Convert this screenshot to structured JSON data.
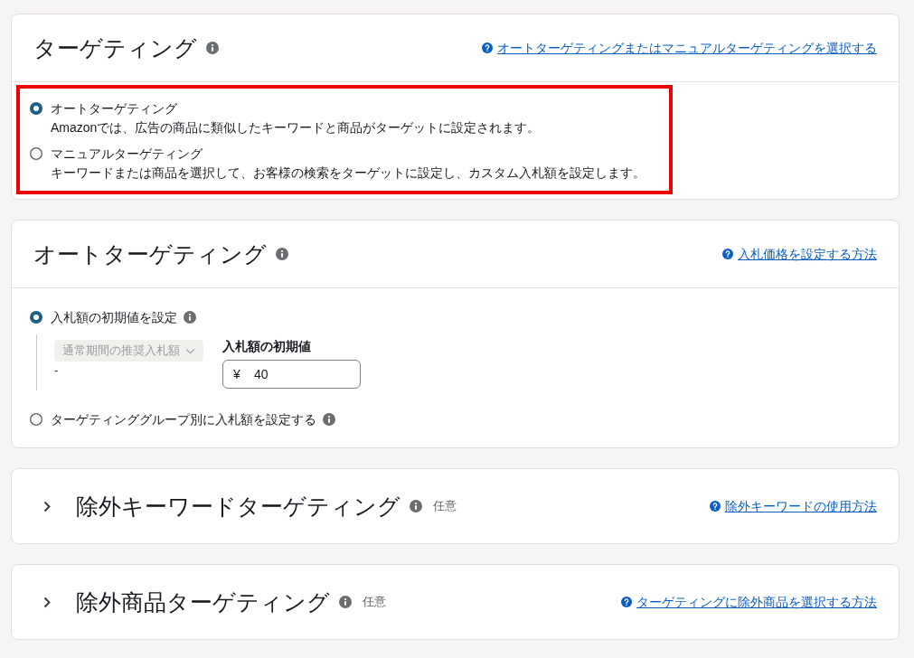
{
  "targeting": {
    "title": "ターゲティング",
    "help_link": "オートターゲティングまたはマニュアルターゲティングを選択する",
    "highlighted": true,
    "options": [
      {
        "label": "オートターゲティング",
        "description": "Amazonでは、広告の商品に類似したキーワードと商品がターゲットに設定されます。",
        "selected": true
      },
      {
        "label": "マニュアルターゲティング",
        "description": "キーワードまたは商品を選択して、お客様の検索をターゲットに設定し、カスタム入札額を設定します。",
        "selected": false
      }
    ]
  },
  "auto_targeting": {
    "title": "オートターゲティング",
    "help_link": "入札価格を設定する方法",
    "options": [
      {
        "label": "入札額の初期値を設定",
        "selected": true,
        "suggested_bid": {
          "dropdown": "通常期間の推奨入札額",
          "disabled": true,
          "value": "-"
        },
        "default_bid": {
          "label": "入札額の初期値",
          "currency": "¥",
          "value": "40"
        }
      },
      {
        "label": "ターゲティンググループ別に入札額を設定する",
        "selected": false
      }
    ]
  },
  "collapsed_sections": [
    {
      "title": "除外キーワードターゲティング",
      "badge": "任意",
      "help_link": "除外キーワードの使用方法",
      "expanded": false
    },
    {
      "title": "除外商品ターゲティング",
      "badge": "任意",
      "help_link": "ターゲティングに除外商品を選択する方法",
      "expanded": false
    }
  ]
}
